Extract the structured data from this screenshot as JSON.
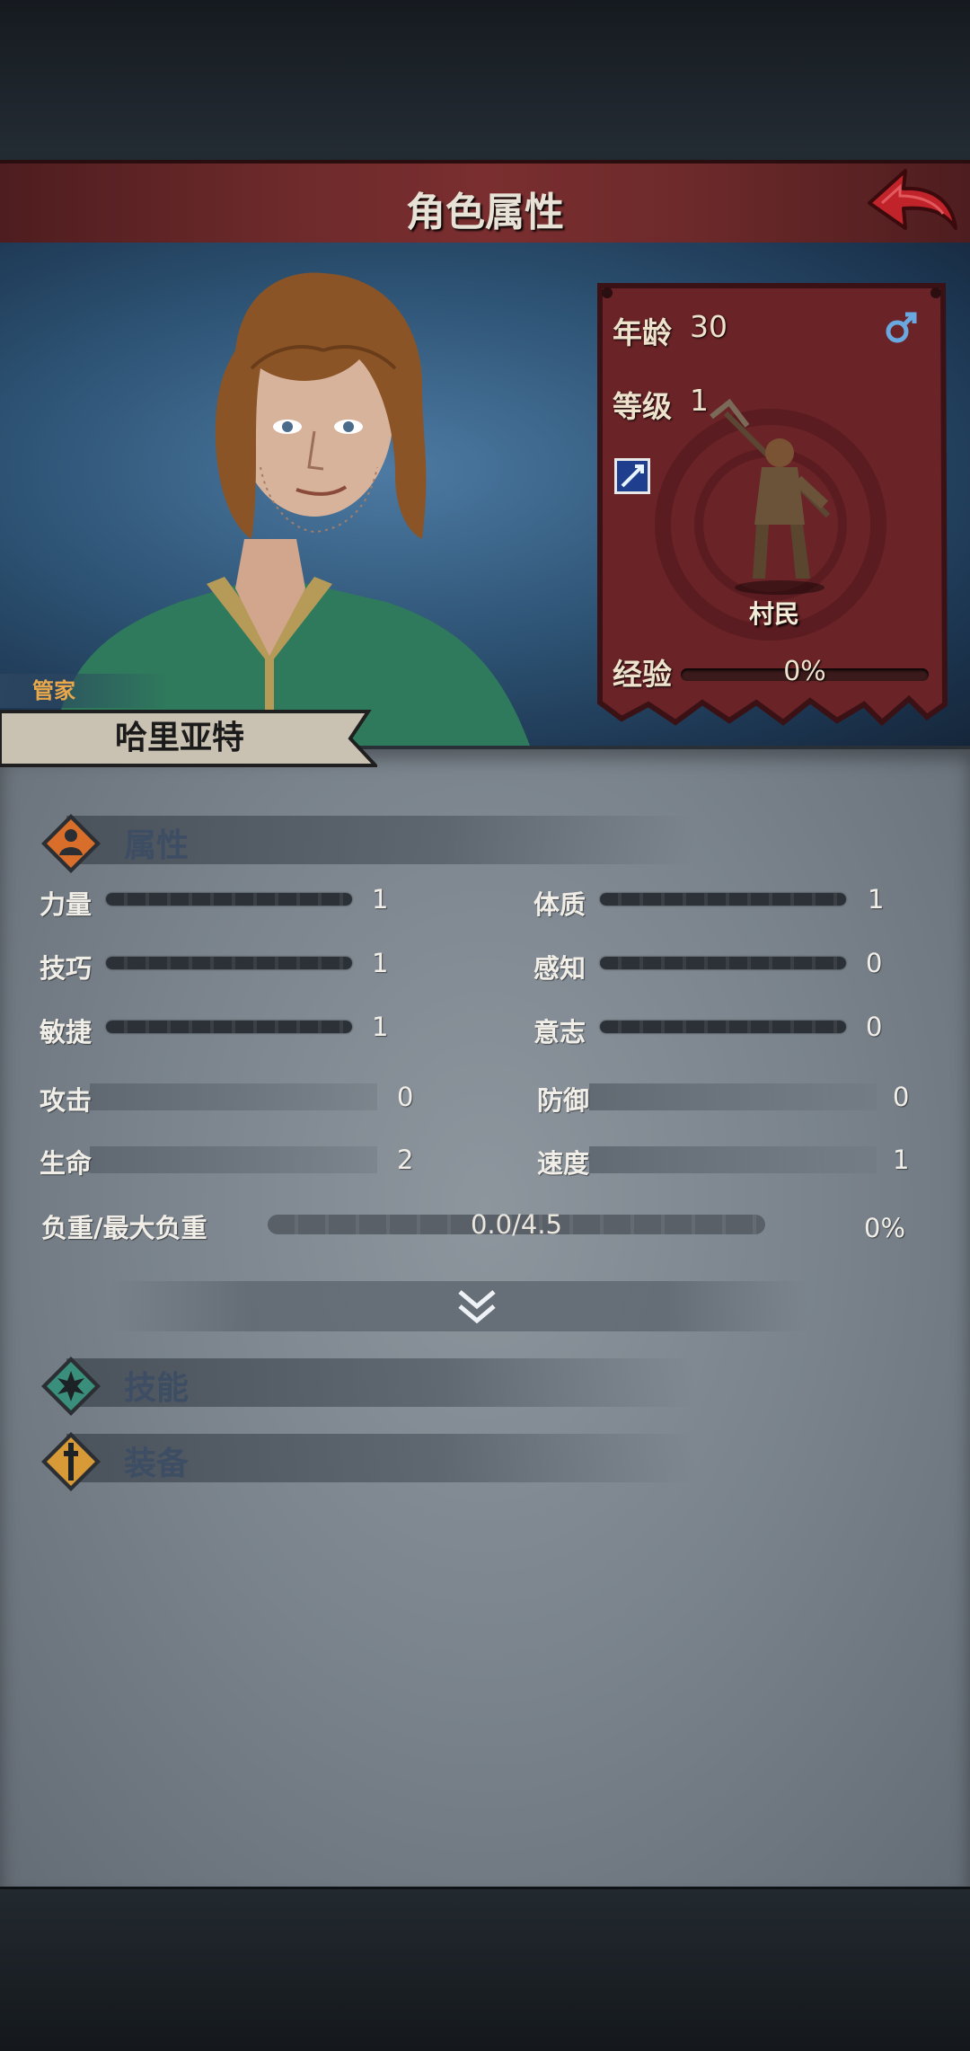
{
  "header": {
    "title": "角色属性"
  },
  "character": {
    "role": "管家",
    "name": "哈里亚特",
    "age_label": "年龄",
    "age": "30",
    "level_label": "等级",
    "level": "1",
    "class_name": "村民",
    "exp_label": "经验",
    "exp_text": "0%",
    "exp_progress": 0
  },
  "attributes": {
    "title": "属性",
    "primary": [
      {
        "label": "力量",
        "value": "1"
      },
      {
        "label": "体质",
        "value": "1"
      },
      {
        "label": "技巧",
        "value": "1"
      },
      {
        "label": "感知",
        "value": "0"
      },
      {
        "label": "敏捷",
        "value": "1"
      },
      {
        "label": "意志",
        "value": "0"
      }
    ],
    "secondary": [
      {
        "label": "攻击",
        "value": "0"
      },
      {
        "label": "防御",
        "value": "0"
      },
      {
        "label": "生命",
        "value": "2"
      },
      {
        "label": "速度",
        "value": "1"
      }
    ],
    "load_label": "负重/最大负重",
    "load_value": "0.0/4.5",
    "load_percent": "0%"
  },
  "skills": {
    "title": "技能"
  },
  "equipment": {
    "title": "装备"
  },
  "colors": {
    "title_bar": "#6e2a2b",
    "card": "#6a2327",
    "accent_orange": "#e9a94a",
    "panel": "#7a838c",
    "skill_icon": "#3a8f7c",
    "equip_icon": "#d89a36",
    "attr_icon": "#d86e2a"
  },
  "icons": [
    "back-arrow-icon",
    "male-icon",
    "sword-icon",
    "villager-figure-icon",
    "attribute-icon",
    "skill-icon",
    "equipment-icon",
    "double-chevron-down-icon"
  ]
}
